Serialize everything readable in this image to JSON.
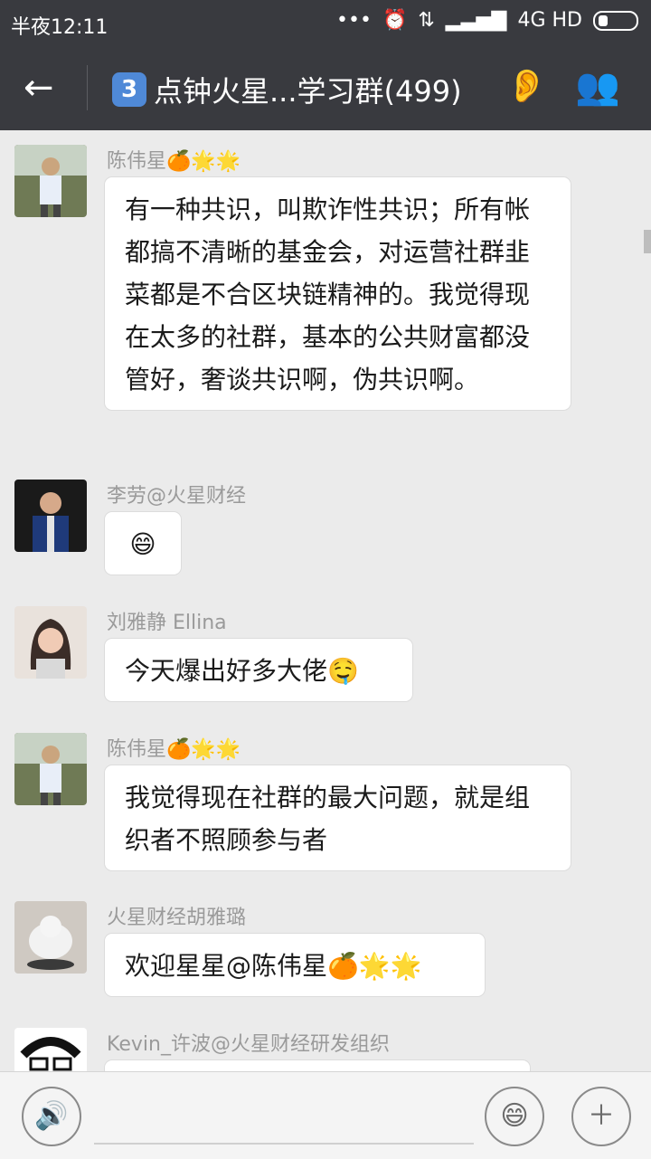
{
  "status": {
    "time": "半夜12:11",
    "network": "4G HD",
    "icons": [
      "alarm-icon",
      "data-arrows-icon",
      "signal-icon",
      "battery-icon"
    ]
  },
  "header": {
    "group_icon": "3",
    "title": "点钟火星...学习群(499)"
  },
  "messages": [
    {
      "sender": "陈伟星🍊🌟🌟",
      "text": "有一种共识，叫欺诈性共识；所有帐都搞不清晰的基金会，对运营社群韭菜都是不合区块链精神的。我觉得现在太多的社群，基本的公共财富都没管好，奢谈共识啊，伪共识啊。"
    },
    {
      "sender": "李劳@火星财经",
      "text": "😄"
    },
    {
      "sender": "刘雅静 Ellina",
      "text": "今天爆出好多大佬🤤"
    },
    {
      "sender": "陈伟星🍊🌟🌟",
      "text": "我觉得现在社群的最大问题，就是组织者不照顾参与者"
    },
    {
      "sender": "火星财经胡雅璐",
      "text": "欢迎星星@陈伟星🍊🌟🌟"
    },
    {
      "sender": "Kevin_许波@火星财经研发组织",
      "text": ""
    }
  ],
  "colors": {
    "header_bg": "#393a3f",
    "chat_bg": "#ebebeb",
    "bubble": "#ffffff"
  }
}
